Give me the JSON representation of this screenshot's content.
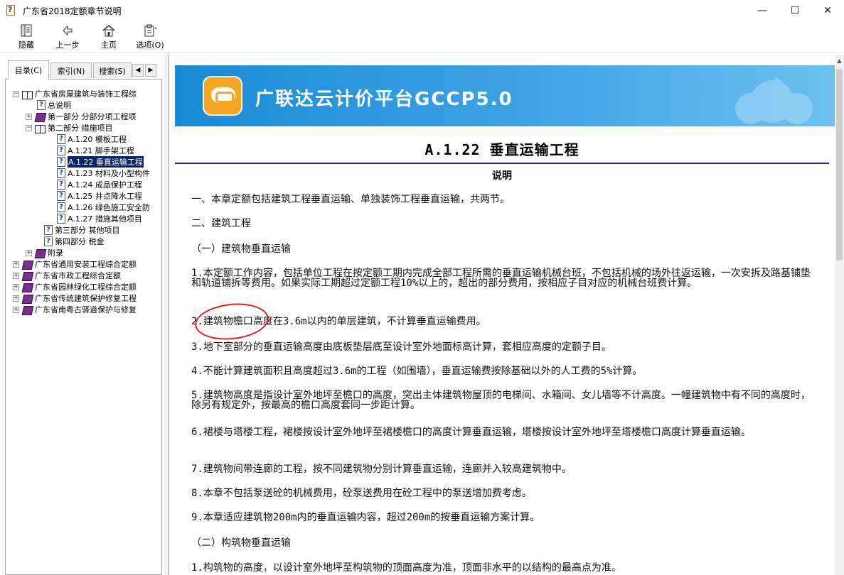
{
  "window": {
    "title": "广东省2018定额章节说明",
    "controls": [
      "—",
      "☐",
      "✕"
    ]
  },
  "toolbar": {
    "hide": "隐藏",
    "back": "上一步",
    "home": "主页",
    "options": "选项(O)"
  },
  "tabs": {
    "contents": "目录(C)",
    "index": "索引(N)",
    "search": "搜索(S)"
  },
  "tree": {
    "root": "广东省房屋建筑与装饰工程综",
    "general": "总说明",
    "part1": "第一部分 分部分项工程项",
    "part2": "第二部分 措施项目",
    "items": [
      "A.1.20 模板工程",
      "A.1.21 脚手架工程",
      "A.1.22 垂直运输工程",
      "A.1.23 材料及小型构件",
      "A.1.24 成品保护工程",
      "A.1.25 井点降水工程",
      "A.1.26 绿色施工安全防",
      "A.1.27 措施其他项目"
    ],
    "part3": "第三部分 其他项目",
    "part4": "第四部分 税金",
    "appendix": "附录",
    "others": [
      "广东省通用安装工程综合定额",
      "广东省市政工程综合定额",
      "广东省园林绿化工程综合定额",
      "广东省传统建筑保护修复工程",
      "广东省南粤古驿道保护与修复"
    ]
  },
  "banner": {
    "title": "广联达云计价平台GCCP5.0"
  },
  "doc": {
    "heading": "A.1.22 垂直运输工程",
    "subheading": "说明",
    "paragraphs": [
      "一、本章定额包括建筑工程垂直运输、单独装饰工程垂直运输，共两节。",
      "二、建筑工程",
      "（一）建筑物垂直运输",
      "1.本定额工作内容，包括单位工程在按定额工期内完成全部工程所需的垂直运输机械台班，不包括机械的场外往返运输，一次安拆及路基铺垫和轨道铺拆等费用。如果实际工期超过定额工程10%以上的，超出的部分费用，按相应子目对应的机械台班费计算。",
      "2.建筑物檐口高度在3.6m以内的单层建筑，不计算垂直运输费用。",
      "3.地下室部分的垂直运输高度由底板垫层底至设计室外地面标高计算，套相应高度的定额子目。",
      "4.不能计算建筑面积且高度超过3.6m的工程（如围墙），垂直运输费按除基础以外的人工费的5%计算。",
      "5.建筑物高度是指设计室外地坪至檐口的高度，突出主体建筑物屋顶的电梯间、水箱间、女儿墙等不计高度。一幢建筑物中有不同的高度时，除另有规定外，按最高的檐口高度套同一步距计算。",
      "6.裙楼与塔楼工程，裙楼按设计室外地坪至裙楼檐口的高度计算垂直运输，塔楼按设计室外地坪至塔楼檐口高度计算垂直运输。",
      "7.建筑物间带连廊的工程，按不同建筑物分别计算垂直运输，连廊并入较高建筑物中。",
      "8.本章不包括泵送砼的机械费用，砼泵送费用在砼工程中的泵送增加费考虑。",
      "9.本章适应建筑物200m内的垂直运输内容，超过200m的按垂直运输方案计算。",
      "（二）构筑物垂直运输",
      "1.构筑物的高度，以设计室外地坪至构筑物的顶面高度为准，顶面非水平的以结构的最高点为准。"
    ]
  },
  "colors": {
    "selection": "#0a246a",
    "heading_rule": "#1c2a9a",
    "annotation": "#e02020",
    "banner": "#1a8ad6"
  }
}
